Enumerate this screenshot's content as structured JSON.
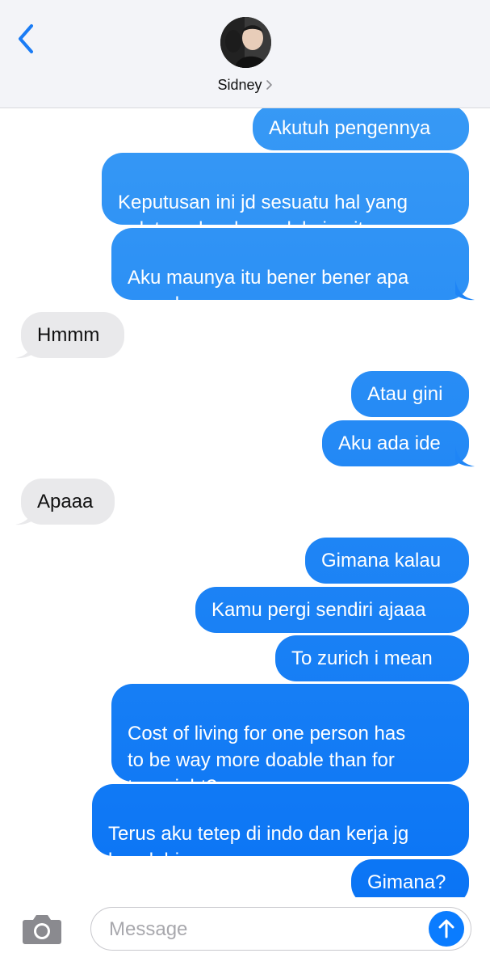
{
  "header": {
    "contact_name": "Sidney"
  },
  "messages": [
    {
      "side": "sent",
      "text": "Akutuh pengennya"
    },
    {
      "side": "sent",
      "text": "Keputusan ini jd sesuatu hal yang\ngak terpaksa kamu lakuin gitu"
    },
    {
      "side": "sent",
      "text": "Aku maunya itu bener bener apa\nyang kamu mau"
    },
    {
      "side": "received",
      "text": "Hmmm"
    },
    {
      "side": "sent",
      "text": "Atau gini"
    },
    {
      "side": "sent",
      "text": "Aku ada ide"
    },
    {
      "side": "received",
      "text": "Apaaa"
    },
    {
      "side": "sent",
      "text": "Gimana kalau"
    },
    {
      "side": "sent",
      "text": "Kamu pergi sendiri ajaaa"
    },
    {
      "side": "sent",
      "text": "To zurich i mean"
    },
    {
      "side": "sent",
      "text": "Cost of living for one person has\nto be way more doable than for\ntwo, right?"
    },
    {
      "side": "sent",
      "text": "Terus aku tetep di indo dan kerja jg\nkayak biasa"
    },
    {
      "side": "sent",
      "text": "Gimana?"
    }
  ],
  "composer": {
    "placeholder": "Message"
  },
  "colors": {
    "sent_top": "#3d9ef5",
    "sent_bottom": "#0a74f5",
    "received": "#e9e9eb",
    "accent": "#0a7cff"
  },
  "icons": [
    "chevron-left-icon",
    "chevron-right-icon",
    "camera-icon",
    "arrow-up-icon"
  ]
}
